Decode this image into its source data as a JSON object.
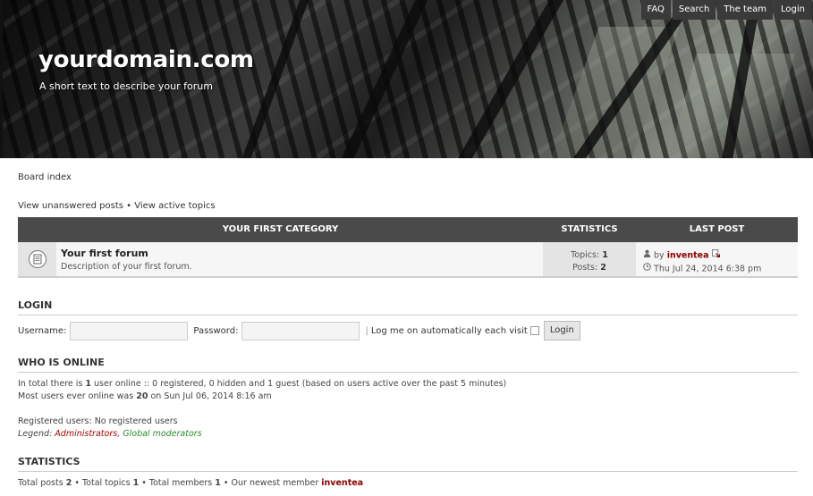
{
  "header": {
    "site_title": "yourdomain.com",
    "site_desc": "A short text to describe your forum",
    "nav": [
      "FAQ",
      "Search",
      "The team",
      "Login"
    ]
  },
  "breadcrumb": "Board index",
  "quicklinks": {
    "unanswered": "View unanswered posts",
    "sep": "•",
    "active": "View active topics"
  },
  "forum_table": {
    "headers": {
      "category": "Your first category",
      "stats": "Statistics",
      "last": "Last post"
    },
    "forum": {
      "title": "Your first forum",
      "desc": "Description of your first forum.",
      "topics_label": "Topics:",
      "topics": "1",
      "posts_label": "Posts:",
      "posts": "2",
      "last_by": "by",
      "last_user": "inventea",
      "last_time": "Thu Jul 24, 2014 6:38 pm"
    }
  },
  "login": {
    "heading": "Login",
    "username_label": "Username:",
    "password_label": "Password:",
    "sep": "|",
    "autologin_label": "Log me on automatically each visit",
    "button": "Login"
  },
  "online": {
    "heading": "Who is online",
    "line1_pre": "In total there is",
    "line1_count": "1",
    "line1_post": "user online :: 0 registered, 0 hidden and 1 guest (based on users active over the past 5 minutes)",
    "line2_pre": "Most users ever online was",
    "line2_count": "20",
    "line2_post": "on Sun Jul 06, 2014 8:16 am",
    "registered": "Registered users: No registered users",
    "legend_label": "Legend:",
    "legend_admin": "Administrators",
    "legend_comma": ",",
    "legend_mod": "Global moderators"
  },
  "statistics": {
    "heading": "Statistics",
    "posts_label": "Total posts",
    "posts": "2",
    "topics_label": "• Total topics",
    "topics": "1",
    "members_label": "• Total members",
    "members": "1",
    "newest_label": "• Our newest member",
    "newest": "inventea"
  },
  "colors": {
    "header_bar": "#4a4a4a",
    "accent_user": "#8b0000",
    "admin": "#aa0000",
    "mod": "#2e8b2e"
  }
}
